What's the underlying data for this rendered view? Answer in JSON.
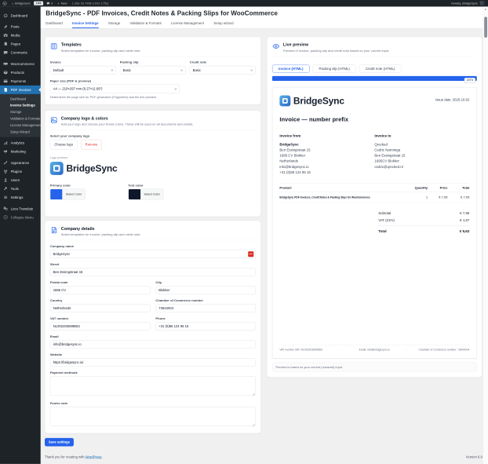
{
  "admin_bar": {
    "site_name": "BridgeSync",
    "live_badge": "Live",
    "comments_count": "0",
    "new_label": "New",
    "stats": "1.38s  93.7MB  0.09s  175Q",
    "howdy": "Howdy, BridgeSync"
  },
  "colors": {
    "accent": "#2563eb",
    "wp_active_blue": "#2271b1",
    "primary_swatch": "#2563eb",
    "text_swatch": "#0f172a",
    "danger": "#d93025"
  },
  "sidebar": {
    "items": [
      {
        "label": "Dashboard",
        "icon": "gauge-icon"
      },
      {
        "label": "Posts",
        "icon": "pin-icon"
      },
      {
        "label": "Media",
        "icon": "camera-icon"
      },
      {
        "label": "Pages",
        "icon": "pages-icon"
      },
      {
        "label": "Comments",
        "icon": "comment-icon"
      },
      {
        "label": "WooCommerce",
        "icon": "woocommerce-icon"
      },
      {
        "label": "Products",
        "icon": "box-icon"
      },
      {
        "label": "Payments",
        "icon": "card-icon"
      },
      {
        "label": "PDF Invoices",
        "icon": "invoice-icon"
      },
      {
        "label": "Analytics",
        "icon": "chart-icon"
      },
      {
        "label": "Marketing",
        "icon": "megaphone-icon"
      },
      {
        "label": "Appearance",
        "icon": "brush-icon"
      },
      {
        "label": "Plugins",
        "icon": "plug-icon"
      },
      {
        "label": "Users",
        "icon": "user-icon"
      },
      {
        "label": "Tools",
        "icon": "wrench-icon"
      },
      {
        "label": "Settings",
        "icon": "sliders-icon"
      },
      {
        "label": "Loco Translate",
        "icon": "translate-icon"
      },
      {
        "label": "Collapse Menu",
        "icon": "collapse-icon"
      }
    ],
    "pdf_submenu": [
      {
        "label": "Dashboard"
      },
      {
        "label": "Invoice Settings"
      },
      {
        "label": "Storage"
      },
      {
        "label": "Validation & Formats"
      },
      {
        "label": "License Management"
      },
      {
        "label": "Setup Wizard"
      }
    ]
  },
  "page": {
    "title": "BridgeSync - PDF Invoices, Credit Notes & Packing Slips for WooCommerce",
    "tabs": [
      {
        "label": "Dashboard"
      },
      {
        "label": "Invoice Settings"
      },
      {
        "label": "Storage"
      },
      {
        "label": "Validation & Formats"
      },
      {
        "label": "License Management"
      },
      {
        "label": "Setup wizard"
      }
    ]
  },
  "templates_card": {
    "title": "Templates",
    "subtitle": "Select templates for invoice, packing slip and credit note",
    "invoice_label": "Invoice",
    "invoice_value": "Default",
    "packing_label": "Packing slip",
    "packing_value": "Basic",
    "credit_label": "Credit note",
    "credit_value": "Basic",
    "paper_label": "Paper size (PDF & preview)",
    "paper_value": "A4 — 210×297 mm (8.27×11.69\")",
    "paper_help": "Determines the page size for PDF generation (Puppeteer) and the live preview."
  },
  "logo_card": {
    "title": "Company logo & colors",
    "subtitle": "Add your logo and choose your brand colors. These will be used on all documents and emails.",
    "select_logo_label": "Select your company logo",
    "choose_button": "Choose logo",
    "remove_button": "Remove",
    "preview_label": "Logo preview",
    "logo_text": "BridgeSync",
    "primary_label": "Primary color",
    "text_label": "Text color",
    "select_color_label": "Select Color"
  },
  "details_card": {
    "title": "Company details",
    "subtitle": "Select templates for invoice, packing slip and credit note",
    "fields": {
      "company_label": "Company name",
      "company_value": "BridgeSync",
      "street_label": "Street",
      "street_value": "Ben Essingstraat 15",
      "postal_label": "Postal code",
      "postal_value": "1685 CV",
      "city_label": "City",
      "city_value": "Blokker",
      "country_label": "Country",
      "country_value": "Netherlands",
      "coc_label": "Chamber of Commerce number",
      "coc_value": "73644004",
      "vat_label": "VAT number",
      "vat_value": "NL002203669B53",
      "phone_label": "Phone",
      "phone_value": "+31 (0)85 124 95 15",
      "email_label": "Email",
      "email_value": "info@bridgesync.io",
      "website_label": "Website",
      "website_value": "https://bridgesync.io/",
      "payment_label": "Payment methods",
      "footer_label": "Footer note"
    }
  },
  "save_button": "Save settings",
  "wp_footer": {
    "thanks_prefix": "Thank you for creating with ",
    "thanks_link": "WordPress",
    "thanks_suffix": ".",
    "version": "Version 6.9"
  },
  "preview": {
    "title": "Live preview",
    "subtitle": "Preview of invoice, packing slip and credit note based on your current input.",
    "chips": [
      {
        "label": "Invoice (HTML)"
      },
      {
        "label": "Packing slip (HTML)"
      },
      {
        "label": "Credit note (HTML)"
      }
    ],
    "progress": "100%",
    "caption": "Preview is based on your current (unsaved) input.",
    "invoice": {
      "logo_text": "BridgeSync",
      "issue_date": "Issue date: 2025-10-02",
      "heading": "Invoice — number prefix",
      "from_title": "Invoice from",
      "from_company": "BridgeSync",
      "from_lines": [
        "Ben Essingstraat 15",
        "1685 CV Blokker",
        "Netherlands",
        "info@bridgesync.io",
        "+31 (0)85 124 95 15"
      ],
      "to_title": "Invoice to",
      "to_lines": [
        "Qrecked",
        "Cedric Narminga",
        "Ben Essingstraat 15",
        "1695CV Blokker",
        "cedric@qrecked.nl"
      ],
      "table": {
        "headers": [
          "Product",
          "Quantity",
          "Price",
          "Total"
        ],
        "row": {
          "product": "BridgeSync PDF Invoices, Credit Notes & Packing Slips for WooCommerce",
          "quantity": "1",
          "price": "€ 7,95",
          "total": "€ 7,95"
        }
      },
      "totals": {
        "subtotal_label": "Subtotal",
        "subtotal_value": "€ 7,95",
        "vat_label": "VAT (21%)",
        "vat_value": "€ 1,67",
        "total_label": "Total",
        "total_value": "€ 9,62"
      },
      "footer_cells": [
        "VAT number VAT: NL002203669B53",
        "Email: info@bridgesync.io",
        "Chamber of Commerce number: 73644004"
      ]
    }
  }
}
